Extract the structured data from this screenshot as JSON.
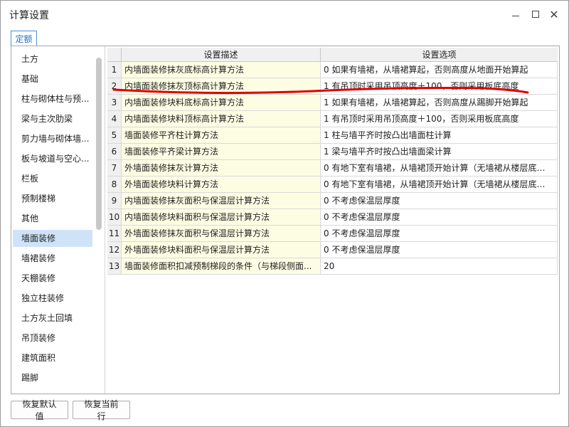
{
  "window": {
    "title": "计算设置",
    "close_glyph": "✕"
  },
  "tabs": [
    {
      "label": "定额",
      "active": true
    }
  ],
  "categories": [
    {
      "label": "土方"
    },
    {
      "label": "基础"
    },
    {
      "label": "柱与砌体柱与预..."
    },
    {
      "label": "梁与主次肋梁"
    },
    {
      "label": "剪力墙与砌体墙..."
    },
    {
      "label": "板与坡道与空心..."
    },
    {
      "label": "栏板"
    },
    {
      "label": "预制楼梯"
    },
    {
      "label": "其他"
    },
    {
      "label": "墙面装修",
      "selected": true
    },
    {
      "label": "墙裙装修"
    },
    {
      "label": "天棚装修"
    },
    {
      "label": "独立柱装修"
    },
    {
      "label": "土方灰土回填"
    },
    {
      "label": "吊顶装修"
    },
    {
      "label": "建筑面积"
    },
    {
      "label": "踢脚"
    }
  ],
  "grid": {
    "columns": [
      "设置描述",
      "设置选项"
    ],
    "rows": [
      {
        "num": "1",
        "desc": "内墙面装修抹灰底标高计算方法",
        "option": "0 如果有墙裙，从墙裙算起，否则高度从地面开始算起"
      },
      {
        "num": "2",
        "desc": "内墙面装修抹灰顶标高计算方法",
        "option": "1 有吊顶时采用吊顶高度＋100，否则采用板底高度"
      },
      {
        "num": "3",
        "desc": "内墙面装修块料底标高计算方法",
        "option": "1 如果有墙裙，从墙裙算起，否则高度从踢脚开始算起"
      },
      {
        "num": "4",
        "desc": "内墙面装修块料顶标高计算方法",
        "option": "1 有吊顶时采用吊顶高度＋100，否则采用板底高度"
      },
      {
        "num": "5",
        "desc": "墙面装修平齐柱计算方法",
        "option": "1 柱与墙平齐时按凸出墙面柱计算"
      },
      {
        "num": "6",
        "desc": "墙面装修平齐梁计算方法",
        "option": "1 梁与墙平齐时按凸出墙面梁计算"
      },
      {
        "num": "7",
        "desc": "外墙面装修抹灰计算方法",
        "option": "0 有地下室有墙裙，从墙裙顶开始计算（无墙裙从楼层底标..."
      },
      {
        "num": "8",
        "desc": "外墙面装修块料计算方法",
        "option": "0 有地下室有墙裙，从墙裙顶开始计算（无墙裙从楼层底标..."
      },
      {
        "num": "9",
        "desc": "内墙面装修抹灰面积与保温层计算方法",
        "option": "0 不考虑保温层厚度"
      },
      {
        "num": "10",
        "desc": "内墙面装修块料面积与保温层计算方法",
        "option": "0 不考虑保温层厚度"
      },
      {
        "num": "11",
        "desc": "外墙面装修抹灰面积与保温层计算方法",
        "option": "0 不考虑保温层厚度"
      },
      {
        "num": "12",
        "desc": "外墙面装修块料面积与保温层计算方法",
        "option": "0 不考虑保温层厚度"
      },
      {
        "num": "13",
        "desc": "墙面装修面积扣减预制梯段的条件（与梯段侧面...",
        "option": "20"
      }
    ]
  },
  "footer": {
    "reset_default_label": "恢复默认值",
    "reset_row_label": "恢复当前行"
  },
  "colors": {
    "selected_bg": "#cfe3f8",
    "desc_bg": "#fdfde4",
    "tab_accent": "#2a6fbf",
    "annotation_red": "#e00000"
  }
}
